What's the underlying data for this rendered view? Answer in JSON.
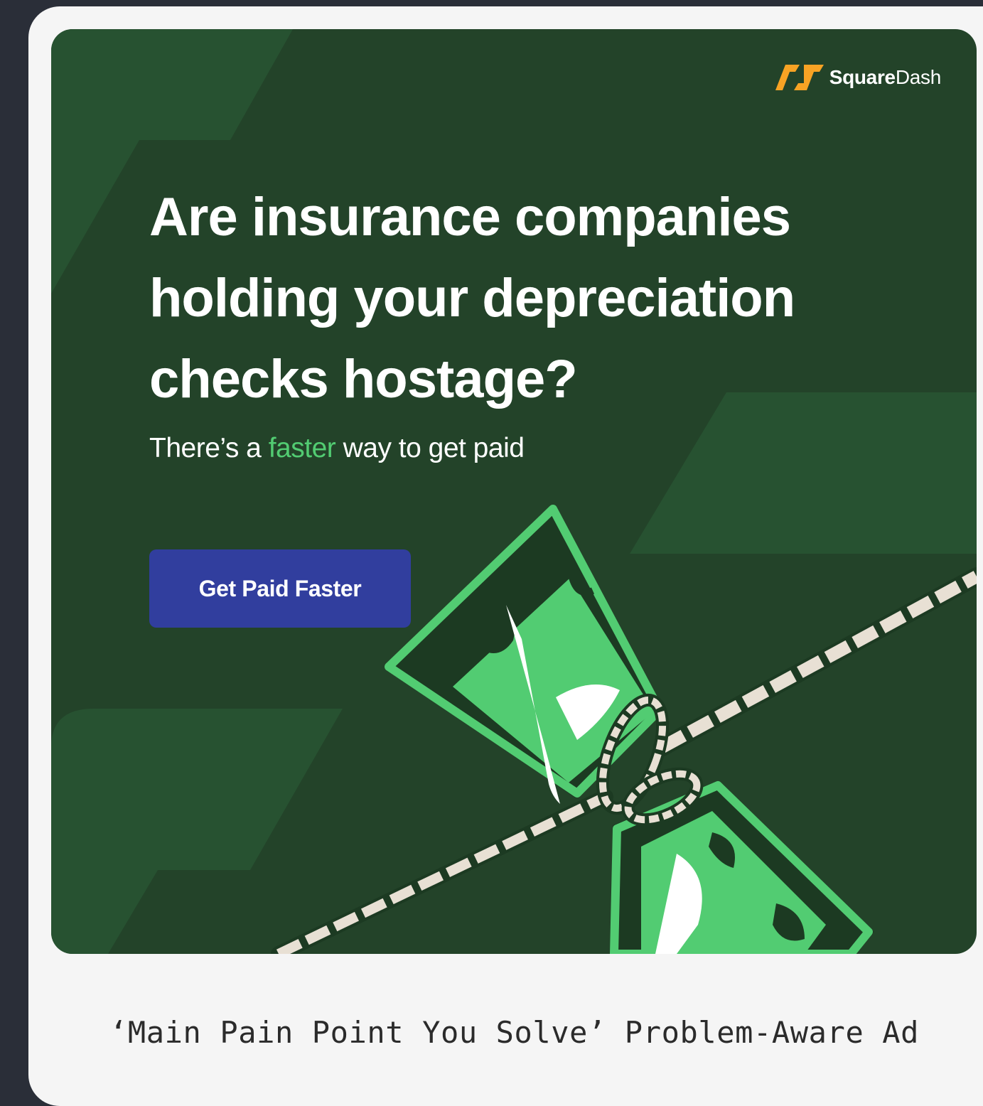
{
  "brand": {
    "name_bold": "Square",
    "name_regular": "Dash",
    "icon": "squaredash-logo-icon",
    "accent_color": "#f7a324"
  },
  "ad": {
    "headline": "Are insurance companies holding your depreciation checks hostage?",
    "subline_before": "There’s a ",
    "subline_accent": "faster",
    "subline_after": " way to get paid",
    "cta_label": "Get Paid Faster",
    "illustration": "money-tied-with-rope-illustration",
    "colors": {
      "background": "#234329",
      "shape": "#275231",
      "money": "#52cc72",
      "cta": "#313e9e",
      "rope": "#e8e0d4"
    }
  },
  "caption": "‘Main Pain Point You Solve’ Problem-Aware Ad"
}
